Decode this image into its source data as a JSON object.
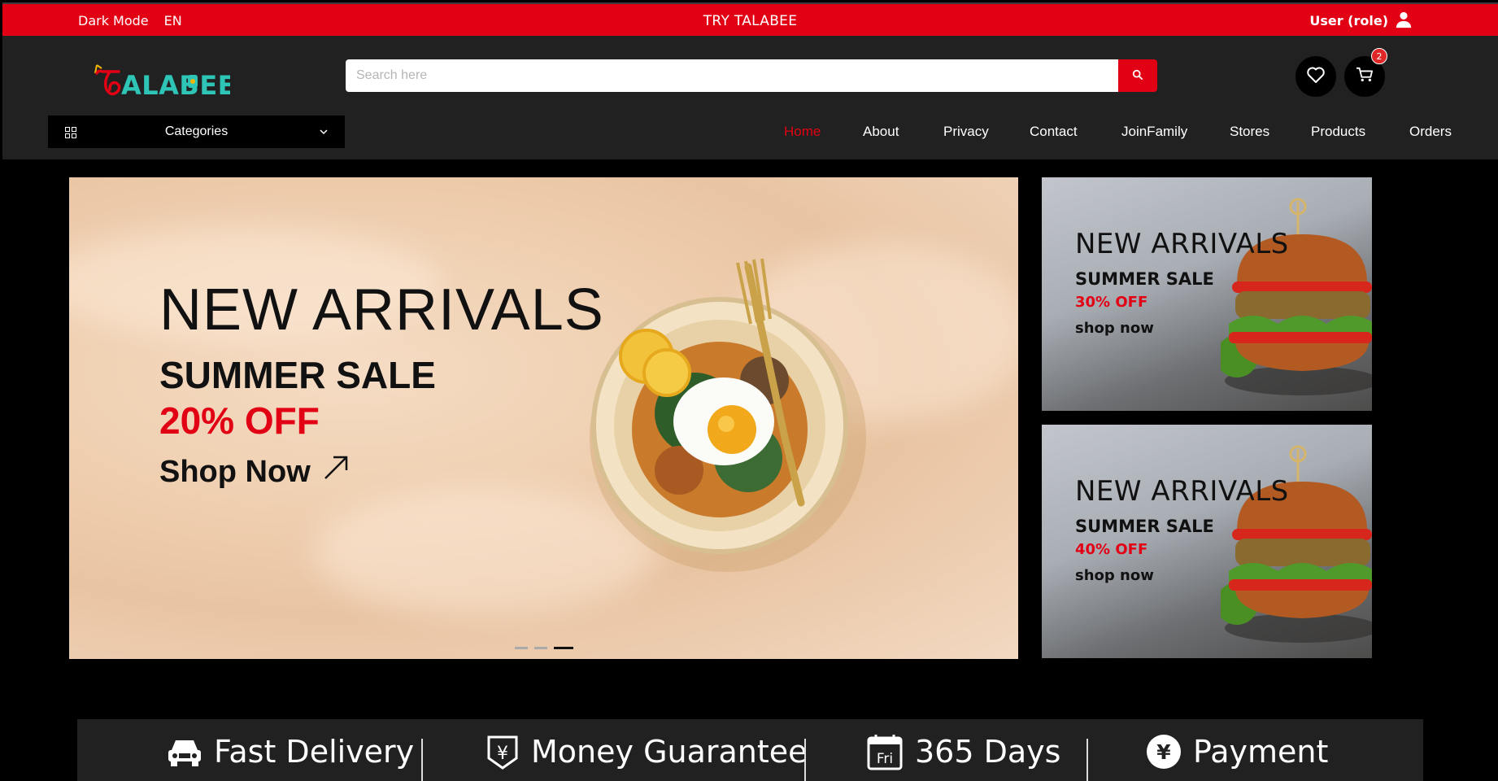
{
  "topbar": {
    "dark_mode": "Dark Mode",
    "language": "EN",
    "promo": "TRY TALABEE",
    "user": "User (role)"
  },
  "header": {
    "logo_text": "ALABEE",
    "search_placeholder": "Search here",
    "cart_count": "2",
    "categories_label": "Categories"
  },
  "nav": {
    "items": [
      "Home",
      "About",
      "Privacy",
      "Contact",
      "JoinFamily",
      "Stores",
      "Products",
      "Orders"
    ],
    "active": "Home"
  },
  "hero": {
    "title": "NEW ARRIVALS",
    "subtitle": "SUMMER SALE",
    "discount": "20% OFF",
    "cta": "Shop Now",
    "slides": 3,
    "active_slide": 3
  },
  "promos": [
    {
      "title": "NEW ARRIVALS",
      "subtitle": "SUMMER SALE",
      "discount": "30% OFF",
      "cta": "shop now"
    },
    {
      "title": "NEW ARRIVALS",
      "subtitle": "SUMMER SALE",
      "discount": "40% OFF",
      "cta": "shop now"
    }
  ],
  "features": [
    {
      "label": "Fast Delivery",
      "icon": "car-icon"
    },
    {
      "label": "Money Guarantee",
      "icon": "yen-badge-icon"
    },
    {
      "label": "365 Days",
      "icon": "calendar-icon",
      "icon_text": "Fri"
    },
    {
      "label": "Payment",
      "icon": "yen-circle-icon"
    }
  ],
  "colors": {
    "accent": "#e10014",
    "header_bg": "#212121",
    "page_bg": "#000000"
  }
}
